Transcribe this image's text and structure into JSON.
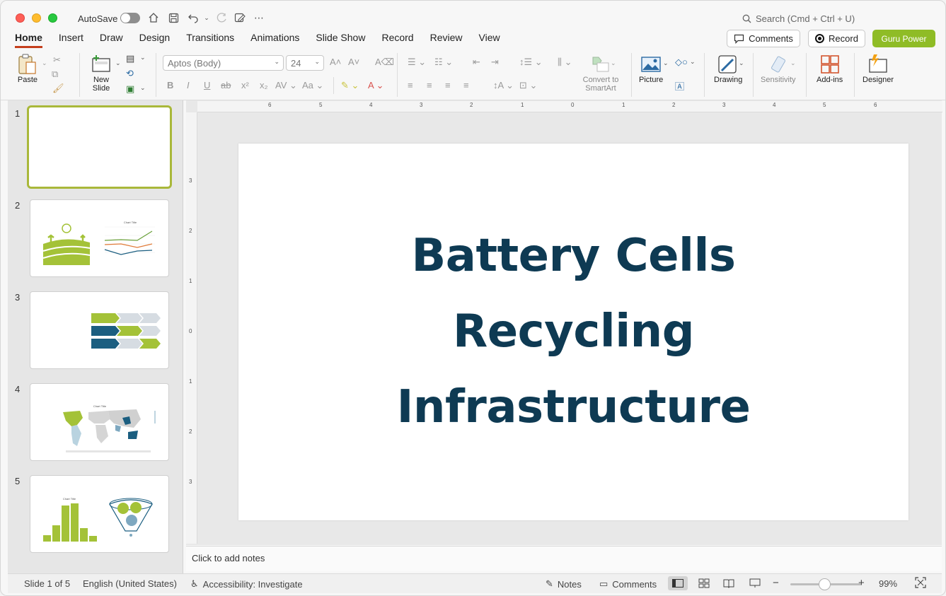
{
  "titlebar": {
    "autosave_label": "AutoSave",
    "search_placeholder": "Search (Cmd + Ctrl + U)"
  },
  "tabs": [
    "Home",
    "Insert",
    "Draw",
    "Design",
    "Transitions",
    "Animations",
    "Slide Show",
    "Record",
    "Review",
    "View"
  ],
  "header_buttons": {
    "comments": "Comments",
    "record": "Record",
    "guru": "Guru Power"
  },
  "ribbon": {
    "paste": "Paste",
    "new_slide": "New Slide",
    "font_name": "Aptos (Body)",
    "font_size": "24",
    "convert_smartart": "Convert to SmartArt",
    "picture": "Picture",
    "drawing": "Drawing",
    "sensitivity": "Sensitivity",
    "addins": "Add-ins",
    "designer": "Designer"
  },
  "slides": [
    {
      "num": "1"
    },
    {
      "num": "2"
    },
    {
      "num": "3"
    },
    {
      "num": "4"
    },
    {
      "num": "5"
    }
  ],
  "slide": {
    "title": "Battery Cells Recycling Infrastructure"
  },
  "notes_placeholder": "Click to add notes",
  "status": {
    "slide_info": "Slide 1 of 5",
    "language": "English (United States)",
    "accessibility": "Accessibility: Investigate",
    "notes": "Notes",
    "comments": "Comments",
    "zoom": "99%"
  },
  "colors": {
    "accent_red": "#c43e1c",
    "guru_green": "#8fbc26",
    "title_navy": "#0e3a53",
    "thumb_green": "#a4c238",
    "thumb_blue": "#1b5e80"
  }
}
